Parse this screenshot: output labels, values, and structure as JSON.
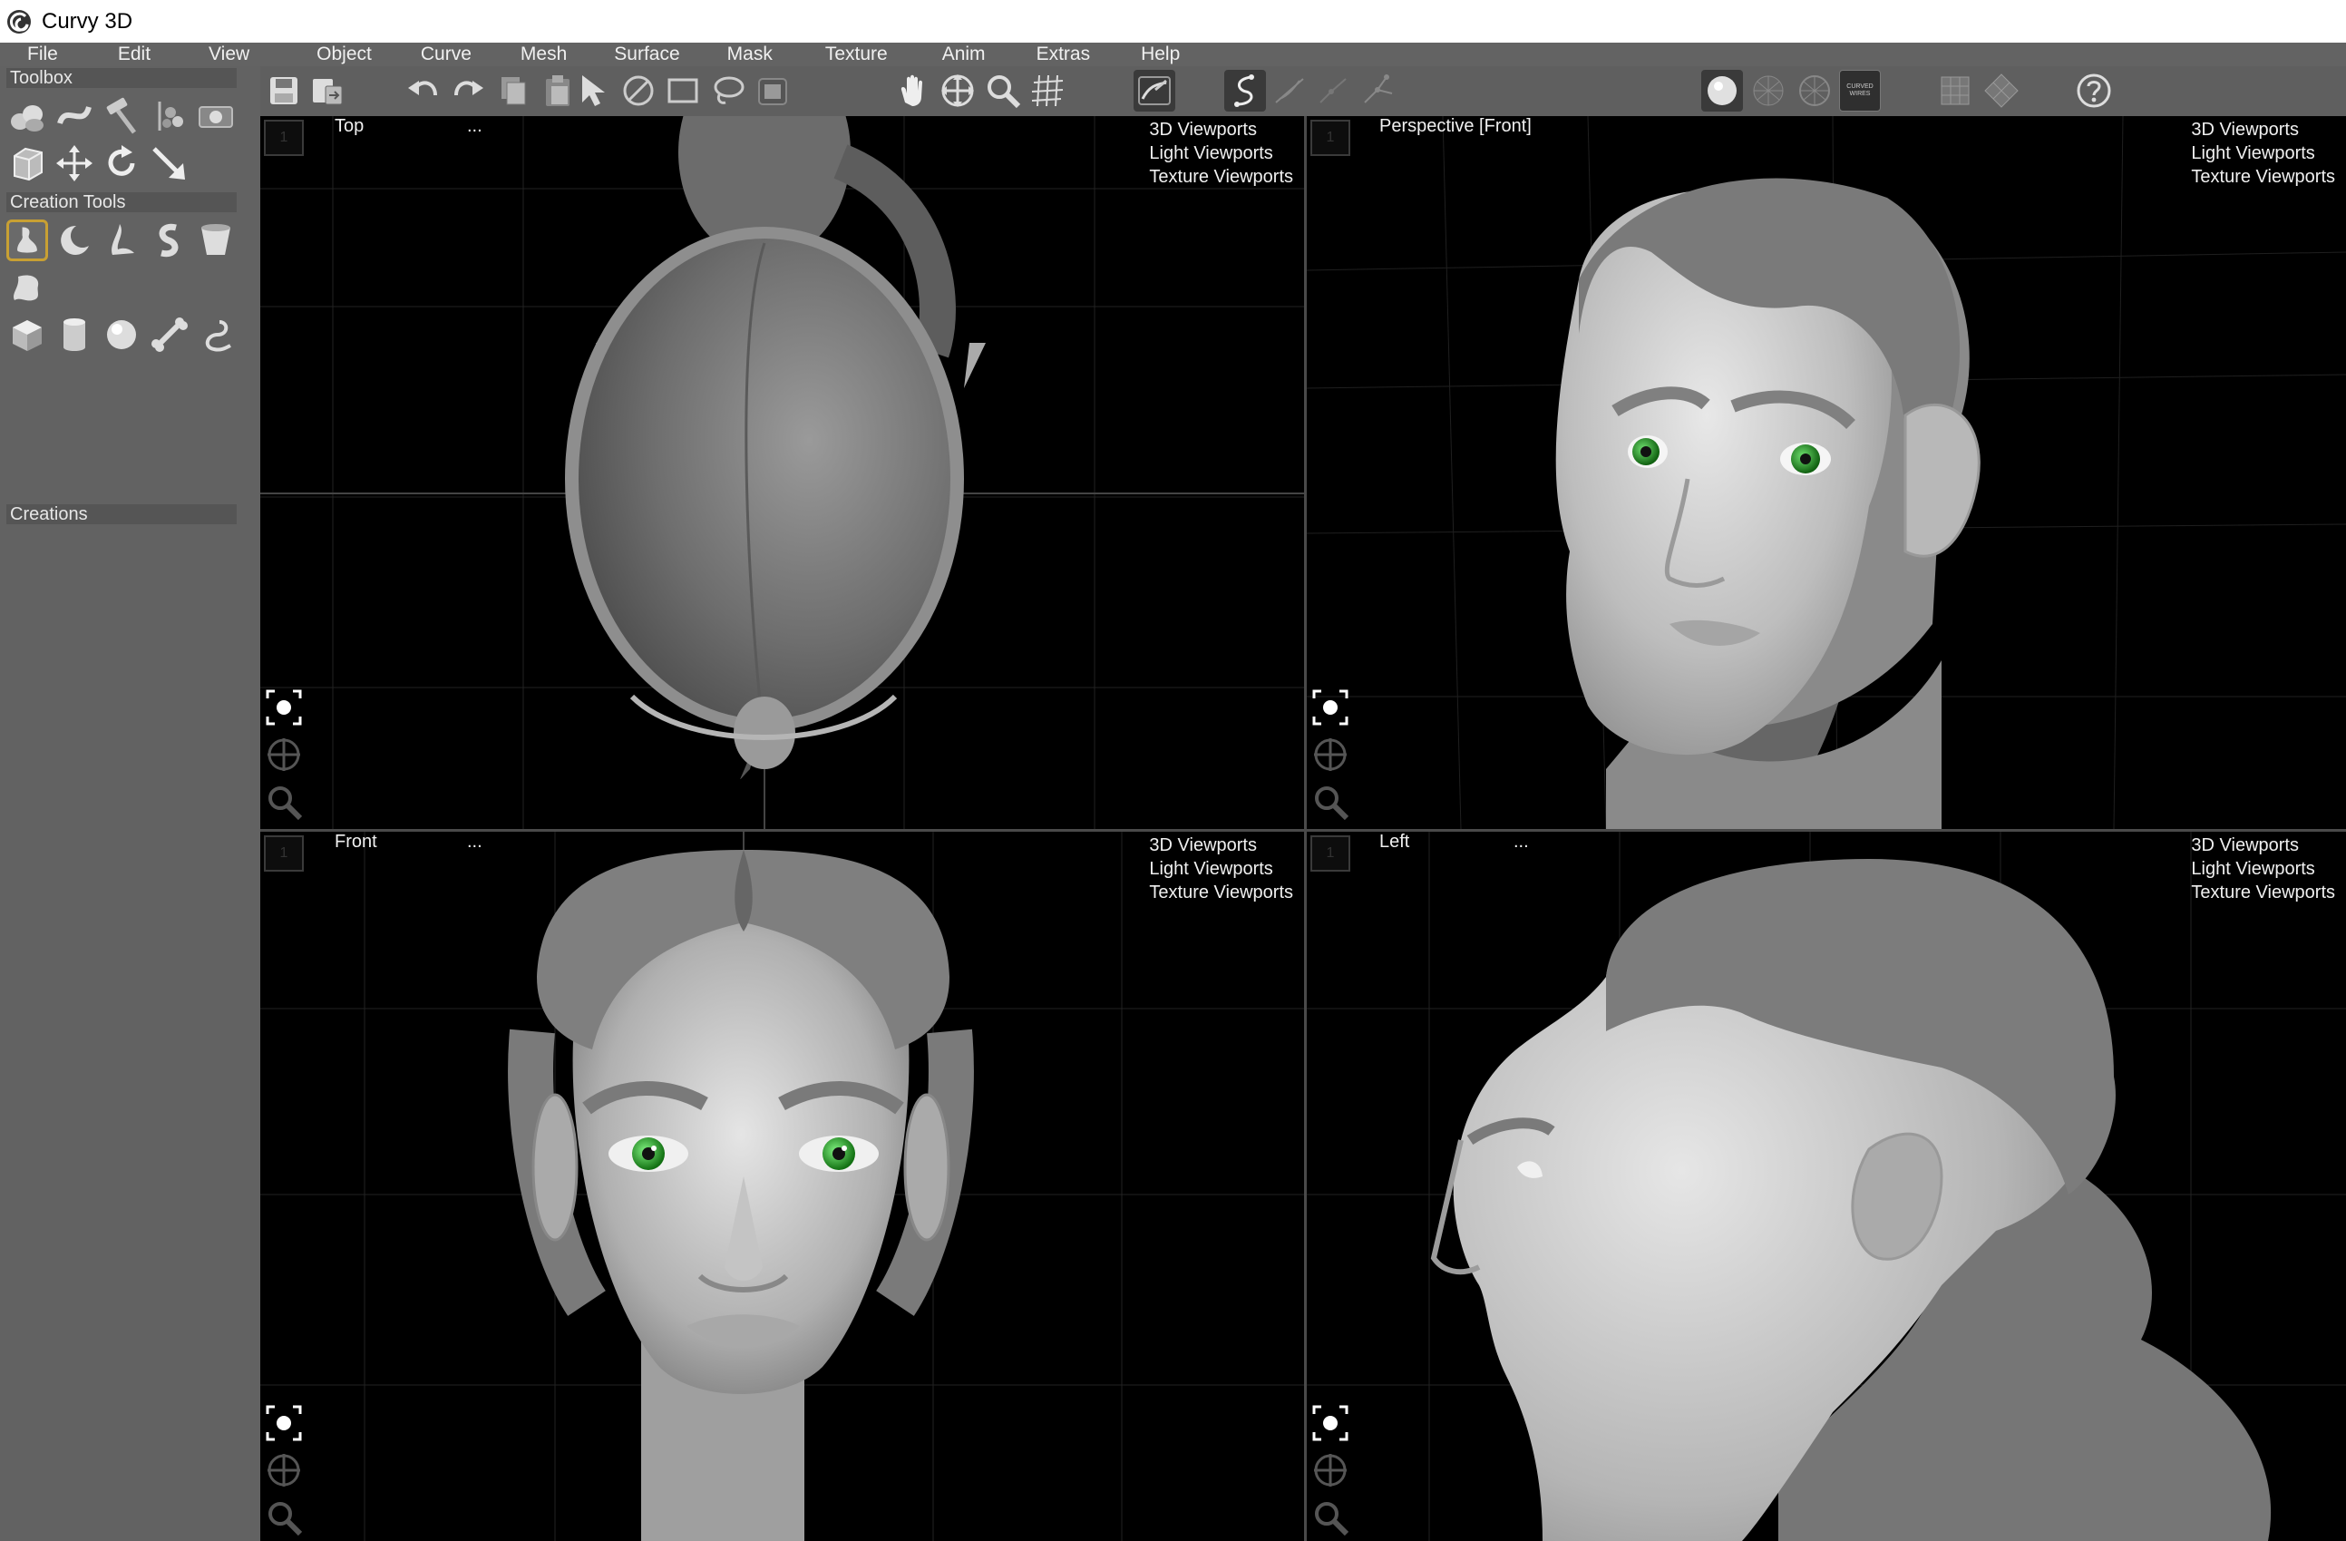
{
  "window": {
    "title": "Curvy 3D",
    "logo_icon": "curvy-swirl-icon"
  },
  "menubar": {
    "items": [
      "File",
      "Edit",
      "View",
      "Object",
      "Curve",
      "Mesh",
      "Surface",
      "Mask",
      "Texture",
      "Anim",
      "Extras",
      "Help"
    ]
  },
  "sidebar": {
    "toolbox_label": "Toolbox",
    "creation_tools_label": "Creation Tools",
    "creations_label": "Creations",
    "toolbox_icons": [
      "curvy-mesh-icon",
      "twist-icon",
      "hammer-icon",
      "layers-icon",
      "viewport-render-icon",
      "bounding-box-icon",
      "move-arrows-icon",
      "rotate-icon",
      "scale-arrow-icon"
    ],
    "creation_icons": [
      "vase-profile-icon",
      "crescent-icon",
      "leaf-shape-icon",
      "s-curve-icon",
      "bucket-icon",
      "blob-icon",
      "cube-icon",
      "cylinder-icon",
      "sphere-icon",
      "bone-icon",
      "hook-tube-icon"
    ]
  },
  "toolbar": {
    "icons": [
      "save-icon",
      "save-as-icon",
      "undo-icon",
      "redo-icon",
      "copy-icon",
      "paste-icon",
      "select-arrow-icon",
      "no-select-icon",
      "rectangle-select-icon",
      "lasso-select-icon",
      "camera-capture-icon",
      "pan-hand-icon",
      "move-view-icon",
      "zoom-icon",
      "grid-icon",
      "sculpt-curve-icon",
      "curve-draw-icon",
      "curve-draw-alt-icon",
      "curve-nodes-icon",
      "curve-points-icon",
      "smooth-shaded-icon",
      "wireframe-shaded-icon",
      "wireframe-icon",
      "curved-wires-icon",
      "texture-grid-icon",
      "uv-diamond-icon",
      "help-icon"
    ],
    "curved_wires_label": "CURVED WIRES"
  },
  "viewports": {
    "menu": {
      "item1": "3D Viewports",
      "item2": "Light Viewports",
      "item3": "Texture Viewports"
    },
    "top": {
      "label": "Top",
      "dots": "..."
    },
    "perspective": {
      "label": "Perspective [Front]",
      "dots": "..."
    },
    "front": {
      "label": "Front",
      "dots": "..."
    },
    "left": {
      "label": "Left",
      "dots": "..."
    },
    "number": "1",
    "nav_icons": [
      "frame-focus-icon",
      "orbit-icon",
      "zoom-icon"
    ]
  },
  "colors": {
    "accent": "#c8a033",
    "background": "#000000",
    "panel": "#626262",
    "toolbar": "#5f5f5f",
    "eye": "#23a823"
  }
}
